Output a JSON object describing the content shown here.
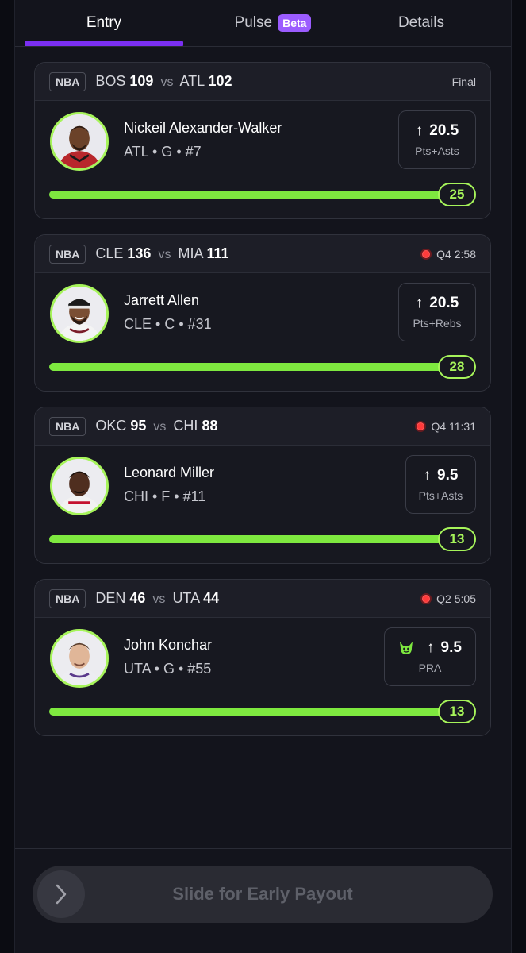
{
  "tabs": {
    "entry": "Entry",
    "pulse": "Pulse",
    "pulse_badge": "Beta",
    "details": "Details"
  },
  "cards": [
    {
      "league": "NBA",
      "team_a": "BOS",
      "score_a": "109",
      "vs": "vs",
      "team_b": "ATL",
      "score_b": "102",
      "status": "Final",
      "live": false,
      "player": "Nickeil Alexander-Walker",
      "meta": "ATL • G • #7",
      "line": "20.5",
      "stat": "Pts+Asts",
      "current": "25",
      "progress": 1.0
    },
    {
      "league": "NBA",
      "team_a": "CLE",
      "score_a": "136",
      "vs": "vs",
      "team_b": "MIA",
      "score_b": "111",
      "status": "Q4 2:58",
      "live": true,
      "player": "Jarrett Allen",
      "meta": "CLE • C • #31",
      "line": "20.5",
      "stat": "Pts+Rebs",
      "current": "28",
      "progress": 1.0
    },
    {
      "league": "NBA",
      "team_a": "OKC",
      "score_a": "95",
      "vs": "vs",
      "team_b": "CHI",
      "score_b": "88",
      "status": "Q4 11:31",
      "live": true,
      "player": "Leonard Miller",
      "meta": "CHI • F • #11",
      "line": "9.5",
      "stat": "Pts+Asts",
      "current": "13",
      "progress": 1.0
    },
    {
      "league": "NBA",
      "team_a": "DEN",
      "score_a": "46",
      "vs": "vs",
      "team_b": "UTA",
      "score_b": "44",
      "status": "Q2 5:05",
      "live": true,
      "player": "John Konchar",
      "meta": "UTA • G • #55",
      "line": "9.5",
      "stat": "PRA",
      "current": "13",
      "progress": 1.0,
      "demon_icon": "demon-icon"
    }
  ],
  "bottom": {
    "slide_label": "Slide for Early Payout",
    "knob_icon": "chevron-right-icon"
  },
  "colors": {
    "accent_purple": "#7b2ff2",
    "progress_green": "#7ee83f",
    "live_red": "#ff3b3b"
  }
}
